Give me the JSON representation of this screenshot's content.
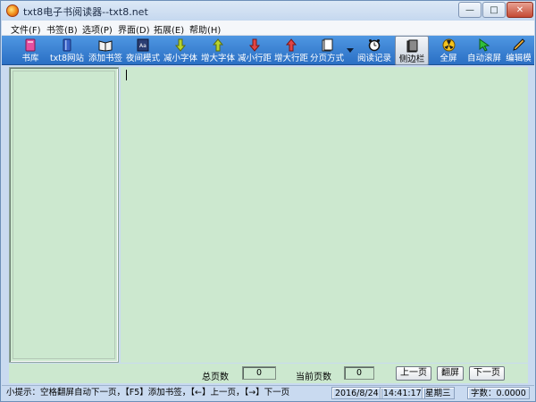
{
  "window": {
    "title": "txt8电子书阅读器--txt8.net"
  },
  "menu": [
    "文件(F)",
    "书签(B)",
    "选项(P)",
    "界面(D)",
    "拓展(E)",
    "帮助(H)"
  ],
  "toolbar": [
    {
      "label": "书库",
      "icon": "books-icon",
      "color": "#e64fa0"
    },
    {
      "label": "txt8网站",
      "icon": "website-icon",
      "color": "#3a62c8"
    },
    {
      "label": "添加书签",
      "icon": "bookmark-icon",
      "color": "#111111"
    },
    {
      "label": "夜间模式",
      "icon": "night-mode-icon",
      "color": "#2b3e73"
    },
    {
      "label": "减小字体",
      "icon": "decrease-font-icon",
      "color": "#b8d42c"
    },
    {
      "label": "增大字体",
      "icon": "increase-font-icon",
      "color": "#b8d42c"
    },
    {
      "label": "减小行距",
      "icon": "decrease-spacing-icon",
      "color": "#e24545"
    },
    {
      "label": "增大行距",
      "icon": "increase-spacing-icon",
      "color": "#e24545"
    },
    {
      "label": "分页方式",
      "icon": "paging-icon",
      "color": "#ffffff"
    },
    {
      "label": "阅读记录",
      "icon": "alarm-clock-icon",
      "color": "#ffffff"
    },
    {
      "label": "侧边栏",
      "icon": "sidebar-icon",
      "color": "#333333"
    },
    {
      "label": "全屏",
      "icon": "fullscreen-icon",
      "color": "#f4c21b"
    },
    {
      "label": "自动滚屏",
      "icon": "auto-scroll-icon",
      "color": "#2fbf3a"
    },
    {
      "label": "编辑模",
      "icon": "edit-pen-icon",
      "color": "#f0b23c"
    }
  ],
  "pagebar": {
    "total_label": "总页数",
    "total_value": "0",
    "current_label": "当前页数",
    "current_value": "0",
    "prev_button": "上一页",
    "flip_button": "翻屏",
    "next_button": "下一页"
  },
  "status": {
    "tip": "小提示：空格翻屏自动下一页，【F5】添加书签，【←】上一页，【→】下一页",
    "date": "2016/8/24",
    "time": "14:41:17",
    "weekday": "星期三",
    "char_count": "字数：0.0000"
  }
}
